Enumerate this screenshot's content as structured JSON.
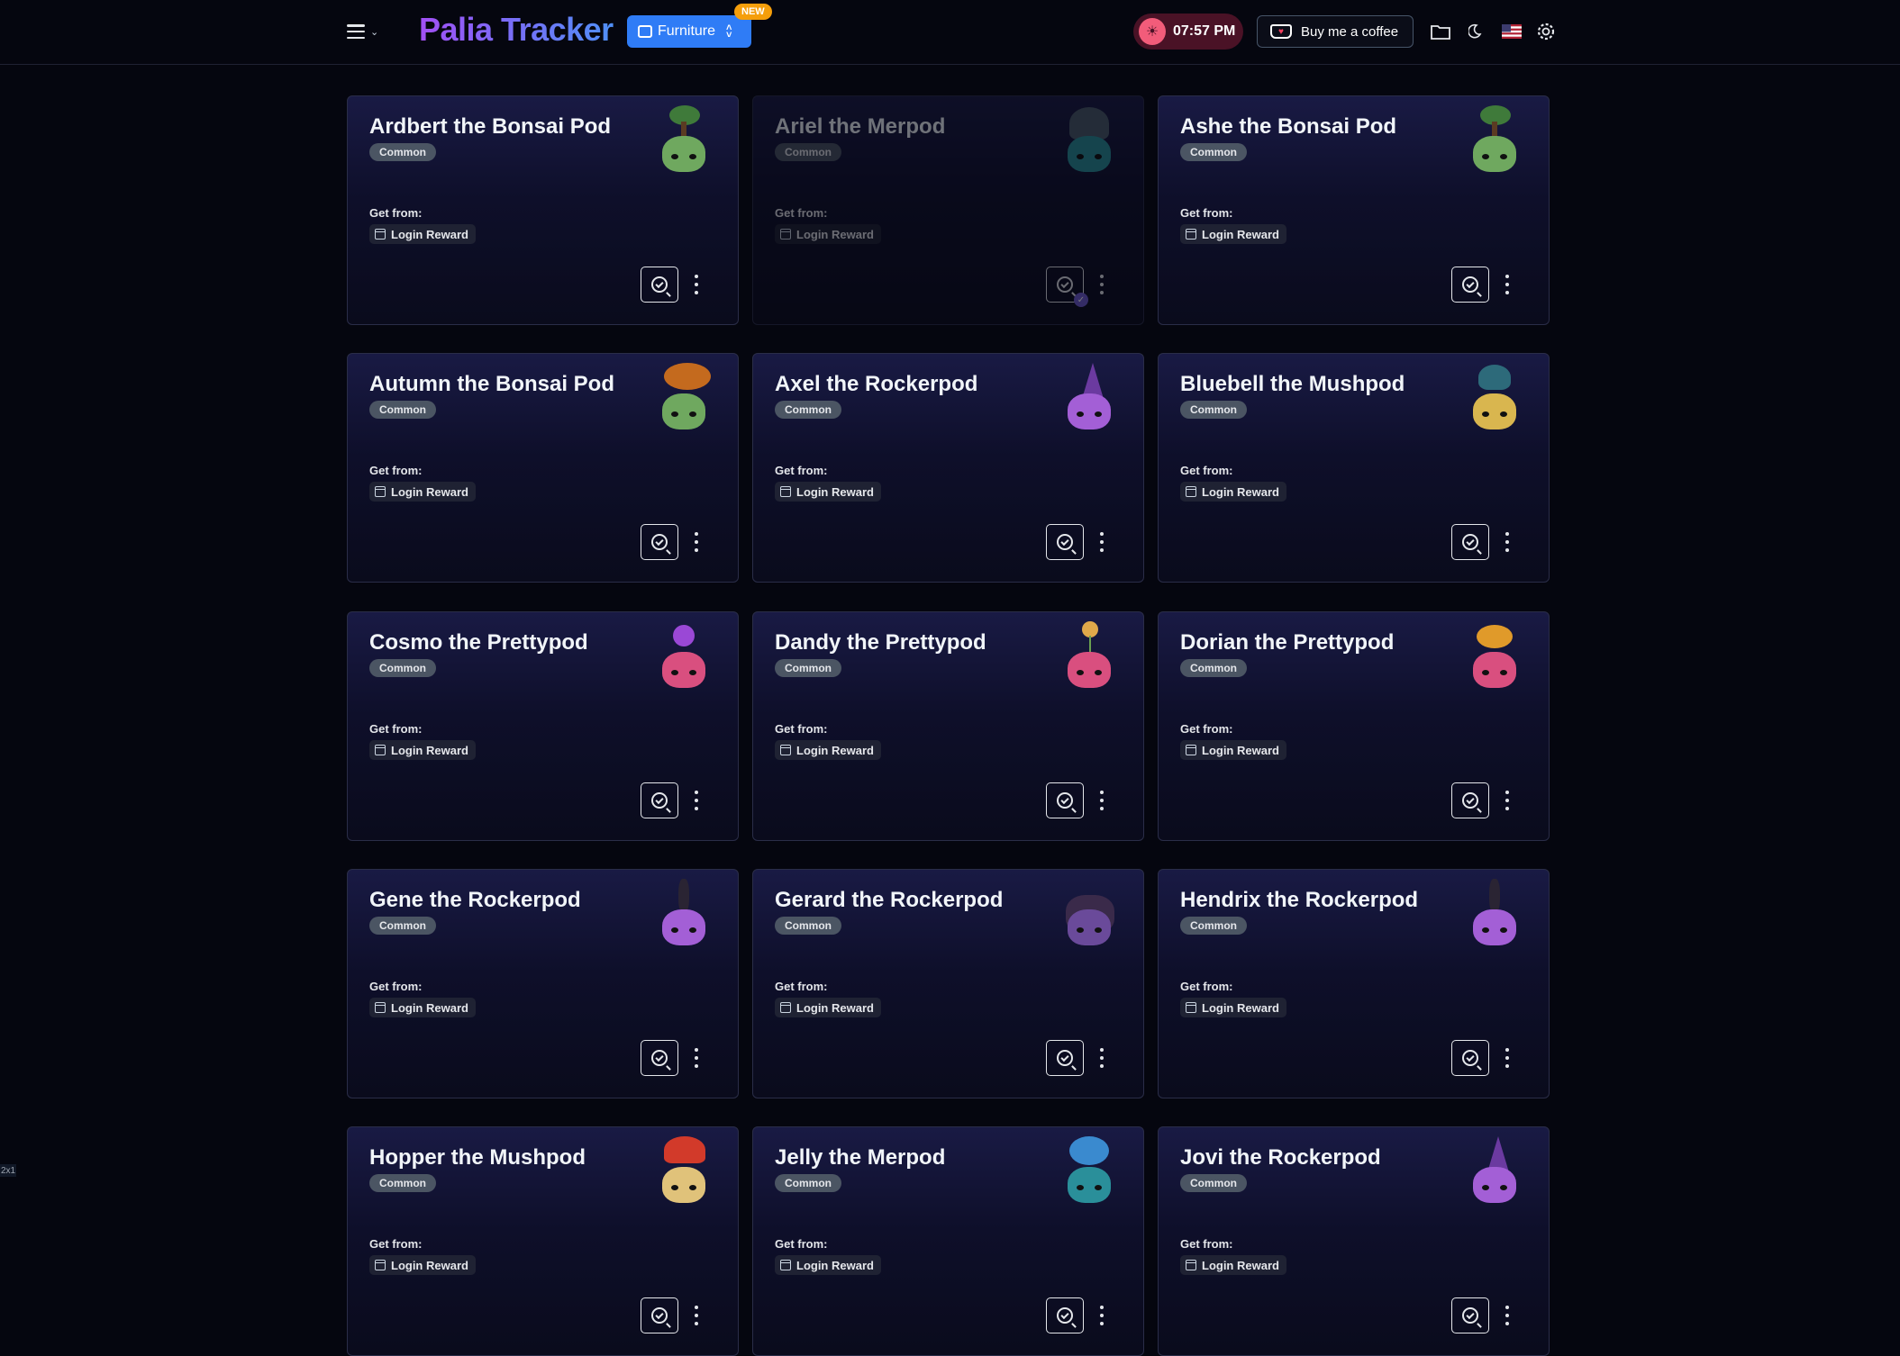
{
  "header": {
    "logo": "Palia Tracker",
    "category": "Furniture",
    "new_badge": "NEW",
    "time": "07:57  PM",
    "coffee_label": "Buy me a coffee"
  },
  "labels": {
    "get_from": "Get from:"
  },
  "cards": [
    {
      "name": "Ardbert the Bonsai Pod",
      "rarity": "Common",
      "source": "Login Reward",
      "tracked": false,
      "color": "#6fa85f",
      "top": "tree"
    },
    {
      "name": "Ariel the Merpod",
      "rarity": "Common",
      "source": "Login Reward",
      "tracked": true,
      "color": "#2a8f9a",
      "top": "shell"
    },
    {
      "name": "Ashe the Bonsai Pod",
      "rarity": "Common",
      "source": "Login Reward",
      "tracked": false,
      "color": "#6fa85f",
      "top": "tree"
    },
    {
      "name": "Autumn the Bonsai Pod",
      "rarity": "Common",
      "source": "Login Reward",
      "tracked": false,
      "color": "#6fa85f",
      "top": "autumn"
    },
    {
      "name": "Axel the Rockerpod",
      "rarity": "Common",
      "source": "Login Reward",
      "tracked": false,
      "color": "#a35fd6",
      "top": "hat"
    },
    {
      "name": "Bluebell the Mushpod",
      "rarity": "Common",
      "source": "Login Reward",
      "tracked": false,
      "color": "#d9b64f",
      "top": "mushroom"
    },
    {
      "name": "Cosmo the Prettypod",
      "rarity": "Common",
      "source": "Login Reward",
      "tracked": false,
      "color": "#d94f7f",
      "top": "flower"
    },
    {
      "name": "Dandy the Prettypod",
      "rarity": "Common",
      "source": "Login Reward",
      "tracked": false,
      "color": "#d94f7f",
      "top": "dandelion"
    },
    {
      "name": "Dorian the Prettypod",
      "rarity": "Common",
      "source": "Login Reward",
      "tracked": false,
      "color": "#d94f7f",
      "top": "bouquet"
    },
    {
      "name": "Gene the Rockerpod",
      "rarity": "Common",
      "source": "Login Reward",
      "tracked": false,
      "color": "#a35fd6",
      "top": "mohawk"
    },
    {
      "name": "Gerard the Rockerpod",
      "rarity": "Common",
      "source": "Login Reward",
      "tracked": false,
      "color": "#6a4a9a",
      "top": "hair"
    },
    {
      "name": "Hendrix the Rockerpod",
      "rarity": "Common",
      "source": "Login Reward",
      "tracked": false,
      "color": "#a35fd6",
      "top": "mohawk"
    },
    {
      "name": "Hopper the Mushpod",
      "rarity": "Common",
      "source": "Login Reward",
      "tracked": false,
      "color": "#e0c27a",
      "top": "redmush"
    },
    {
      "name": "Jelly the Merpod",
      "rarity": "Common",
      "source": "Login Reward",
      "tracked": false,
      "color": "#2a8f9a",
      "top": "jelly"
    },
    {
      "name": "Jovi the Rockerpod",
      "rarity": "Common",
      "source": "Login Reward",
      "tracked": false,
      "color": "#a35fd6",
      "top": "hat"
    }
  ],
  "corner_indicator": "2x1"
}
